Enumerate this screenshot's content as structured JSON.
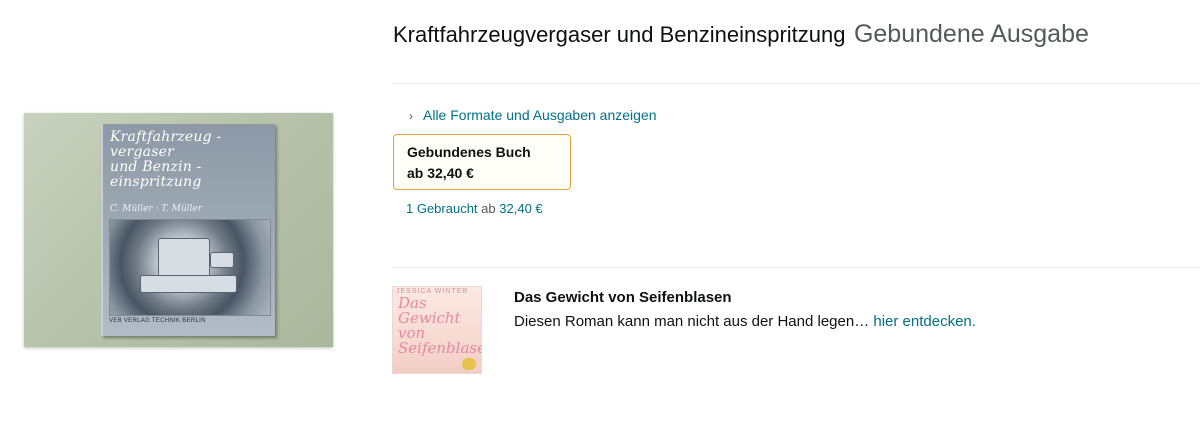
{
  "product": {
    "title": "Kraftfahrzeugvergaser und Benzineinspritzung",
    "format_label": "Gebundene Ausgabe"
  },
  "cover": {
    "title": "Kraftfahrzeug -\nvergaser\nund Benzin -\neinspritzung",
    "authors": "C. Müller · T. Müller",
    "publisher": "VEB VERLAG TECHNIK BERLIN"
  },
  "formats": {
    "all_formats_link": "Alle Formate und Ausgaben anzeigen",
    "selected": {
      "name": "Gebundenes Buch",
      "price": "ab 32,40 €"
    },
    "used": {
      "count_label": "1 Gebraucht",
      "from_label": "ab",
      "price": "32,40 €"
    }
  },
  "promo": {
    "cover_author": "JESSICA WINTER",
    "cover_title": "Das\nGewicht\nvon\nSeifenblasen",
    "title": "Das Gewicht von Seifenblasen",
    "text": "Diesen Roman kann man nicht aus der Hand legen…",
    "link": "hier entdecken."
  },
  "colors": {
    "link": "#007185",
    "format_border": "#e3a23f",
    "secondary_text": "#565959"
  }
}
